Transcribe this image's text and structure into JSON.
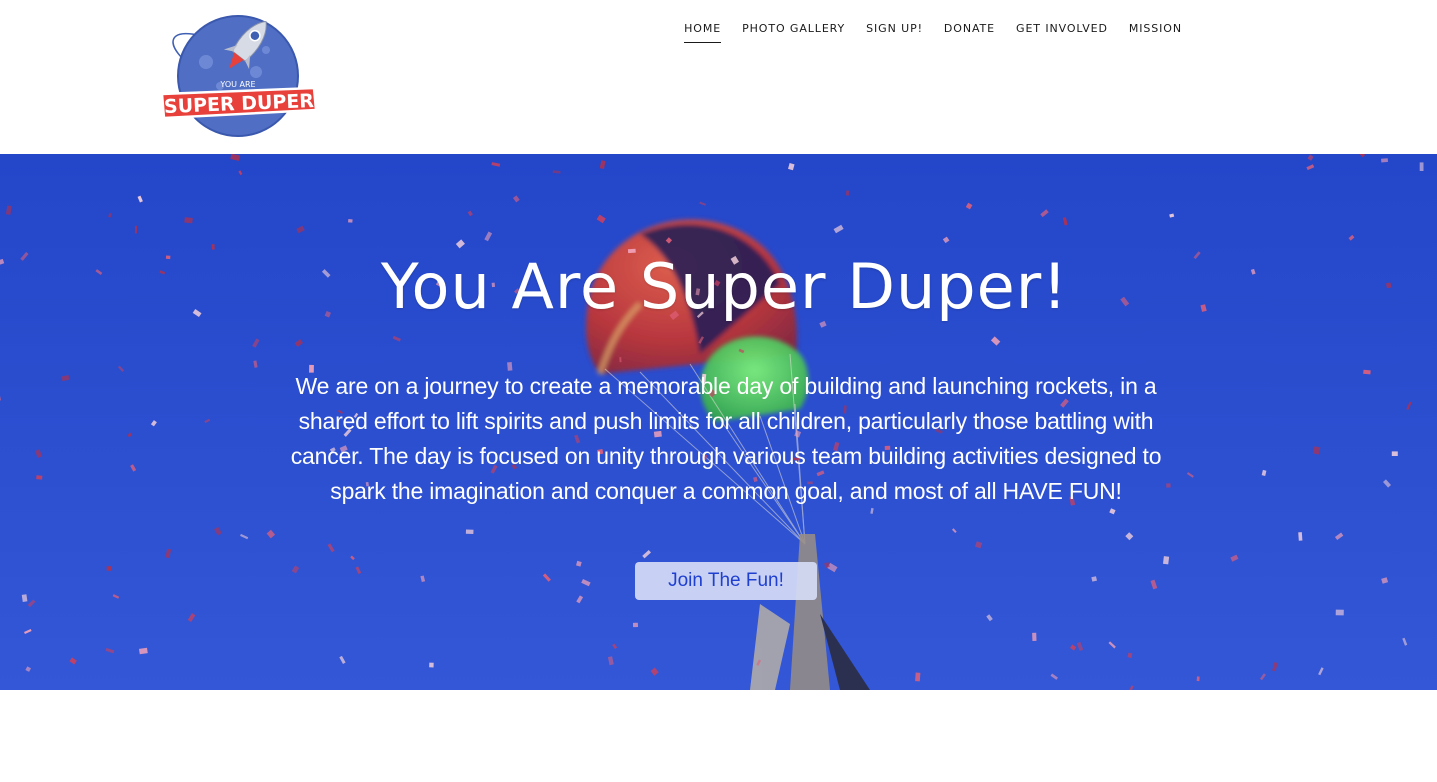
{
  "logo": {
    "top_text": "YOU ARE",
    "main_text": "SUPER DUPER"
  },
  "nav": {
    "items": [
      {
        "label": "HOME",
        "active": true
      },
      {
        "label": "PHOTO GALLERY",
        "active": false
      },
      {
        "label": "SIGN UP!",
        "active": false
      },
      {
        "label": "DONATE",
        "active": false
      },
      {
        "label": "GET INVOLVED",
        "active": false
      },
      {
        "label": "MISSION",
        "active": false
      }
    ]
  },
  "hero": {
    "title": "You Are Super Duper!",
    "body": "We are on a journey to create a memorable day of building and launching rockets, in a shared effort to lift spirits and push limits for all children, particularly those battling with cancer. The day is focused on unity through various team building activities designed to spark the imagination and conquer a common goal, and most of all HAVE FUN!",
    "button_label": "Join The Fun!"
  },
  "colors": {
    "accent": "#1f3fd1",
    "hero_blue": "#2c4fd4",
    "logo_blue": "#3f5fb3",
    "logo_red": "#e8403a"
  }
}
